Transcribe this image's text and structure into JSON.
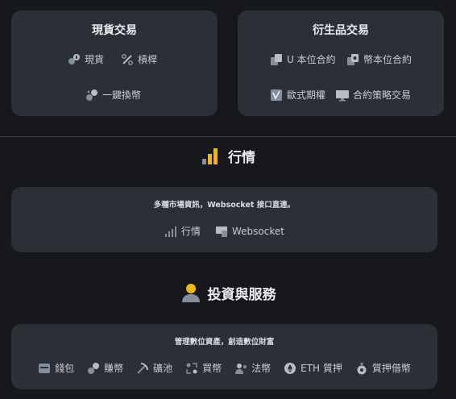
{
  "spot": {
    "title": "現貨交易",
    "items": [
      {
        "label": "現貨",
        "icon": "spot-icon"
      },
      {
        "label": "槓桿",
        "icon": "margin-icon"
      },
      {
        "label": "一鍵換幣",
        "icon": "convert-icon"
      }
    ]
  },
  "derivatives": {
    "title": "衍生品交易",
    "items": [
      {
        "label": "U 本位合約",
        "icon": "usdm-futures-icon"
      },
      {
        "label": "幣本位合約",
        "icon": "coinm-futures-icon"
      },
      {
        "label": "歐式期權",
        "icon": "options-icon"
      },
      {
        "label": "合約策略交易",
        "icon": "strategy-trading-icon"
      }
    ]
  },
  "market": {
    "heading": "行情",
    "subtitle": "多種市場資訊，Websocket 接口直連。",
    "items": [
      {
        "label": "行情",
        "icon": "signal-bars-icon"
      },
      {
        "label": "Websocket",
        "icon": "websocket-icon"
      }
    ]
  },
  "invest": {
    "heading": "投資與服務",
    "subtitle": "管理數位資產，創造數位財富",
    "items": [
      {
        "label": "錢包",
        "icon": "wallet-icon"
      },
      {
        "label": "賺幣",
        "icon": "earn-icon"
      },
      {
        "label": "礦池",
        "icon": "mining-icon"
      },
      {
        "label": "買幣",
        "icon": "buy-crypto-icon"
      },
      {
        "label": "法幣",
        "icon": "fiat-icon"
      },
      {
        "label": "ETH 質押",
        "icon": "eth-staking-icon"
      },
      {
        "label": "質押借幣",
        "icon": "crypto-loan-icon"
      }
    ]
  },
  "colors": {
    "background": "#17181c",
    "card": "#2b2f36",
    "accent": "#f0b90b",
    "text": "#eaecef",
    "muted": "#848e9c"
  }
}
